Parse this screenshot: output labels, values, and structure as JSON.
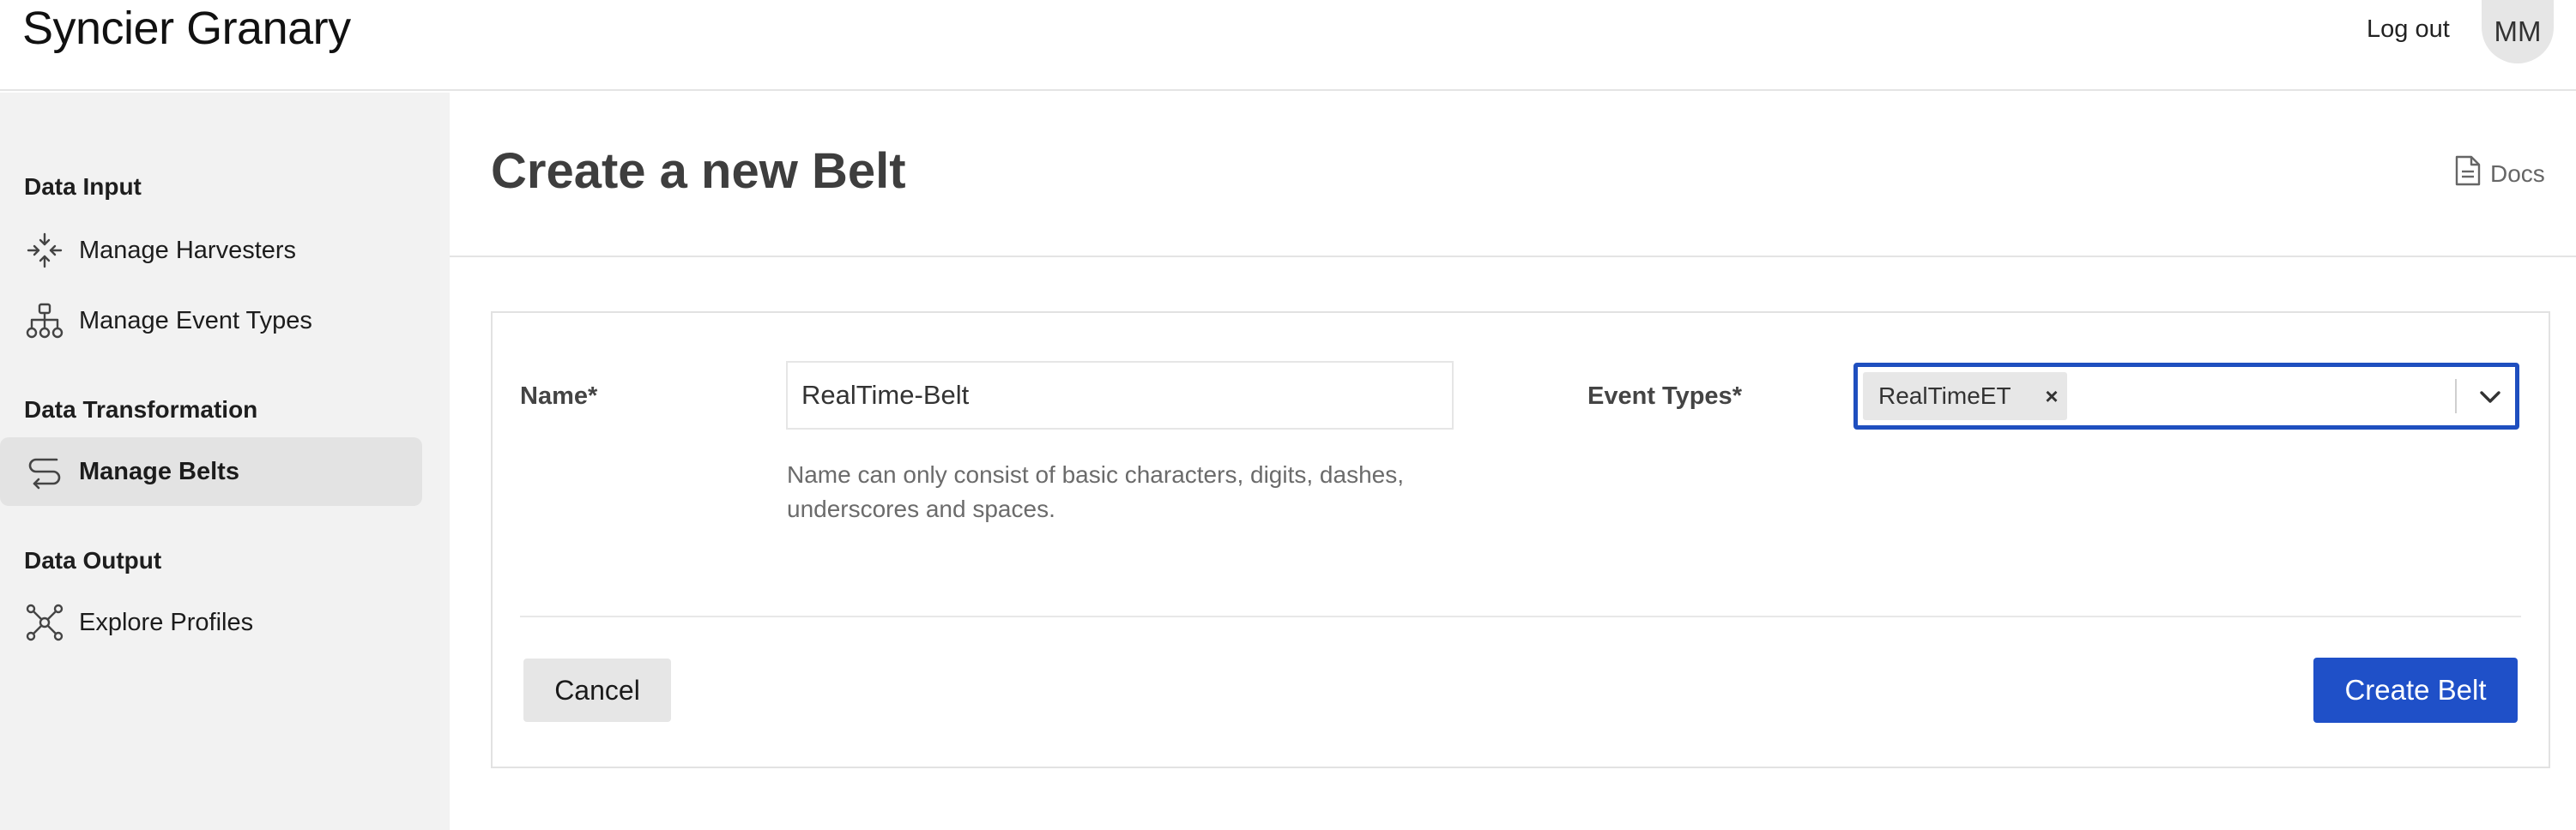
{
  "header": {
    "app_title": "Syncier Granary",
    "logout_label": "Log out",
    "avatar_initials": "MM"
  },
  "sidebar": {
    "sections": [
      {
        "title": "Data Input",
        "items": [
          {
            "label": "Manage Harvesters",
            "icon": "arrows-collapse-icon"
          },
          {
            "label": "Manage Event Types",
            "icon": "hierarchy-icon"
          }
        ]
      },
      {
        "title": "Data Transformation",
        "items": [
          {
            "label": "Manage Belts",
            "icon": "belt-path-icon",
            "active": true
          }
        ]
      },
      {
        "title": "Data Output",
        "items": [
          {
            "label": "Explore Profiles",
            "icon": "network-icon"
          }
        ]
      }
    ]
  },
  "main": {
    "page_title": "Create a new Belt",
    "docs_label": "Docs",
    "form": {
      "name_label": "Name*",
      "name_value": "RealTime-Belt",
      "name_help": "Name can only consist of basic characters, digits, dashes, underscores and spaces.",
      "event_types_label": "Event Types*",
      "event_types_selected": [
        "RealTimeET"
      ],
      "remove_chip_symbol": "×"
    },
    "actions": {
      "cancel_label": "Cancel",
      "create_label": "Create Belt"
    }
  },
  "colors": {
    "primary": "#1f50c8",
    "focus_border": "#1f4fbf",
    "sidebar_bg": "#f2f2f2",
    "active_item_bg": "#e3e3e3"
  }
}
